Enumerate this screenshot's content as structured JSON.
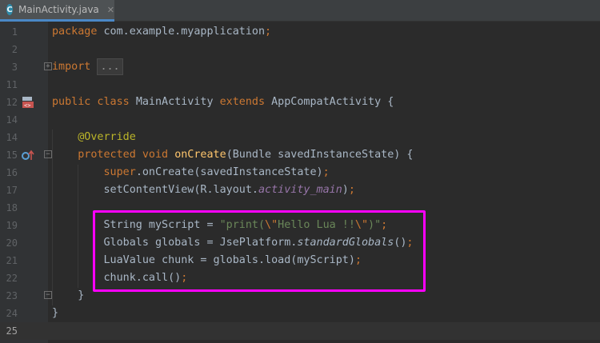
{
  "tab": {
    "label": "MainActivity.java",
    "icon_letter": "C",
    "icon": "class-icon",
    "close_glyph": "✕"
  },
  "accent": {
    "highlight_box": "#ff00ff",
    "tab_underline": "#4a88c7"
  },
  "lines": [
    {
      "no": "1",
      "tokens": [
        {
          "t": "package",
          "c": "kw"
        },
        {
          "t": " com.example.myapplication"
        },
        {
          "t": ";",
          "c": "kw"
        }
      ]
    },
    {
      "no": "2",
      "tokens": []
    },
    {
      "no": "3",
      "tokens": [
        {
          "t": "import",
          "c": "kw"
        },
        {
          "t": " "
        },
        {
          "t": "...",
          "c": "collapsed"
        }
      ],
      "fold": "+"
    },
    {
      "no": "11",
      "tokens": []
    },
    {
      "no": "12",
      "tokens": [
        {
          "t": "public class ",
          "c": "kw"
        },
        {
          "t": "MainActivity "
        },
        {
          "t": "extends ",
          "c": "kw"
        },
        {
          "t": "AppCompatActivity {"
        }
      ],
      "gutter_icon": "android-activity-icon"
    },
    {
      "no": "14",
      "tokens": []
    },
    {
      "no": "14",
      "tokens": [
        {
          "t": "    "
        },
        {
          "t": "@Override",
          "c": "ann"
        }
      ]
    },
    {
      "no": "15",
      "tokens": [
        {
          "t": "    "
        },
        {
          "t": "protected void ",
          "c": "kw"
        },
        {
          "t": "onCreate",
          "c": "fn"
        },
        {
          "t": "(Bundle savedInstanceState) {"
        }
      ],
      "fold": "−",
      "gutter_icon": "override-method-icon"
    },
    {
      "no": "16",
      "tokens": [
        {
          "t": "        "
        },
        {
          "t": "super",
          "c": "kw"
        },
        {
          "t": ".onCreate(savedInstanceState)"
        },
        {
          "t": ";",
          "c": "kw"
        }
      ]
    },
    {
      "no": "17",
      "tokens": [
        {
          "t": "        setContentView(R.layout."
        },
        {
          "t": "activity_main",
          "c": "purple"
        },
        {
          "t": ")"
        },
        {
          "t": ";",
          "c": "kw"
        }
      ]
    },
    {
      "no": "18",
      "tokens": []
    },
    {
      "no": "19",
      "tokens": [
        {
          "t": "        String myScript = "
        },
        {
          "t": "\"print(",
          "c": "str"
        },
        {
          "t": "\\\"",
          "c": "esc"
        },
        {
          "t": "Hello Lua !!",
          "c": "str"
        },
        {
          "t": "\\\"",
          "c": "esc"
        },
        {
          "t": ")\"",
          "c": "str"
        },
        {
          "t": ";",
          "c": "kw"
        }
      ]
    },
    {
      "no": "20",
      "tokens": [
        {
          "t": "        Globals globals = JsePlatform."
        },
        {
          "t": "standardGlobals",
          "c": "italic"
        },
        {
          "t": "()"
        },
        {
          "t": ";",
          "c": "kw"
        }
      ]
    },
    {
      "no": "21",
      "tokens": [
        {
          "t": "        LuaValue chunk = globals.load(myScript)"
        },
        {
          "t": ";",
          "c": "kw"
        }
      ]
    },
    {
      "no": "22",
      "tokens": [
        {
          "t": "        chunk.call()"
        },
        {
          "t": ";",
          "c": "kw"
        }
      ]
    },
    {
      "no": "23",
      "tokens": [
        {
          "t": "    }"
        }
      ],
      "fold": "−"
    },
    {
      "no": "24",
      "tokens": [
        {
          "t": "}"
        }
      ]
    },
    {
      "no": "25",
      "tokens": [],
      "current": true
    }
  ]
}
